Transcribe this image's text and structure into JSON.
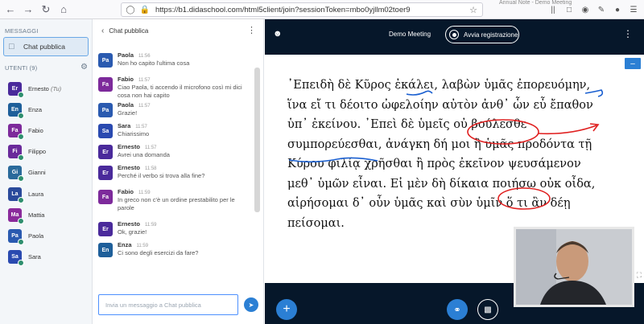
{
  "browser": {
    "url": "https://b1.didaschool.com/html5client/join?sessionToken=mbo0yjllm02toer9",
    "tab_title": "Annual Note - Demo Meeting"
  },
  "sidebar": {
    "messages_label": "MESSAGGI",
    "public_chat_label": "Chat pubblica",
    "users_label": "UTENTI (9)",
    "users": [
      {
        "initials": "Er",
        "name": "Ernesto",
        "suffix": "(Tu)",
        "color": "#4a2a9b"
      },
      {
        "initials": "En",
        "name": "Enza",
        "suffix": "",
        "color": "#1e5f9a"
      },
      {
        "initials": "Fa",
        "name": "Fabio",
        "suffix": "",
        "color": "#7d2a9b"
      },
      {
        "initials": "Fi",
        "name": "Filippo",
        "suffix": "",
        "color": "#6a2a9b"
      },
      {
        "initials": "Gi",
        "name": "Gianni",
        "suffix": "",
        "color": "#2a6a9b"
      },
      {
        "initials": "La",
        "name": "Laura",
        "suffix": "",
        "color": "#2a4a9b"
      },
      {
        "initials": "Ma",
        "name": "Mattia",
        "suffix": "",
        "color": "#8a2a9b"
      },
      {
        "initials": "Pa",
        "name": "Paola",
        "suffix": "",
        "color": "#2a5ab0"
      },
      {
        "initials": "Sa",
        "name": "Sara",
        "suffix": "",
        "color": "#2a4ab0"
      }
    ]
  },
  "chat": {
    "title": "Chat pubblica",
    "input_placeholder": "Invia un messaggio a Chat pubblica",
    "messages": [
      {
        "initials": "Pa",
        "name": "Paola",
        "time": "11:56",
        "text": "Non ho capito l'ultima cosa",
        "color": "#2a5ab0"
      },
      {
        "initials": "Fa",
        "name": "Fabio",
        "time": "11:57",
        "text": "Ciao Paola, ti accendo il microfono così mi dici cosa non hai capito",
        "color": "#7d2a9b"
      },
      {
        "initials": "Pa",
        "name": "Paola",
        "time": "11:57",
        "text": "Grazie!",
        "color": "#2a5ab0"
      },
      {
        "initials": "Sa",
        "name": "Sara",
        "time": "11:57",
        "text": "Chiarissimo",
        "color": "#2a4ab0"
      },
      {
        "initials": "Er",
        "name": "Ernesto",
        "time": "11:57",
        "text": "Avrei una domanda",
        "color": "#4a2a9b"
      },
      {
        "initials": "Er",
        "name": "Ernesto",
        "time": "11:58",
        "text": "Perché il verbo si trova alla fine?",
        "color": "#4a2a9b"
      },
      {
        "initials": "Fa",
        "name": "Fabio",
        "time": "11:59",
        "text": "In greco non c'è un ordine prestabilito per le parole",
        "color": "#7d2a9b"
      },
      {
        "initials": "Er",
        "name": "Ernesto",
        "time": "11:59",
        "text": "Ok, grazie!",
        "color": "#4a2a9b"
      },
      {
        "initials": "En",
        "name": "Enza",
        "time": "11:59",
        "text": "Ci sono degli esercizi da fare?",
        "color": "#1e5f9a"
      }
    ]
  },
  "main": {
    "meeting_title": "Demo Meeting",
    "record_label": "Avvia registrazione"
  },
  "slide": {
    "lines": [
      "᾿Επειδὴ δὲ Κῦρος ἐκάλει, λαβὼν ὑμᾶς ἐπορευόμην,",
      "ἵνα εἴ τι δέοιτο ὠφελοίην αὐτὸν ἀνθ᾿ ὧν εὖ ἔπαθον",
      "ὑπ᾿ ἐκείνου. ᾿Επεὶ δὲ ὑμεῖς οὐ βούλεσθε",
      "συμπορεύεσθαι, ἀνάγκη δή μοι ἢ ὑμᾶς προδόντα τῇ",
      "Κύρου φιλίᾳ χρῆσθαι ἢ πρὸς ἐκεῖνον ψευσάμενον",
      "μεθ᾿ ὑμῶν εἶναι. Εἰ μὲν δὴ δίκαια ποιήσω οὐκ οἶδα,",
      "αἱρήσομαι δ᾿ οὖν ὑμᾶς καὶ σὺν ὑμῖν ὅ τι ἂν δέῃ",
      "πείσομαι."
    ]
  },
  "colors": {
    "accent": "#2b7fd4",
    "dark_bg": "#06172a",
    "annotation_red": "#e02020",
    "annotation_blue": "#1a5fd0"
  }
}
